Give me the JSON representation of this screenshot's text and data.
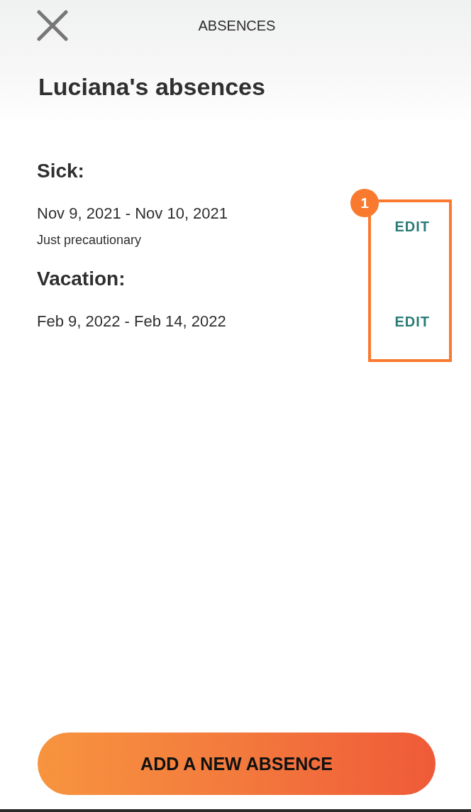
{
  "header": {
    "title": "ABSENCES"
  },
  "heading": "Luciana's absences",
  "absences": [
    {
      "category": "Sick:",
      "dates": "Nov 9, 2021 - Nov 10, 2021",
      "note": "Just precautionary",
      "action": "EDIT"
    },
    {
      "category": "Vacation:",
      "dates": "Feb 9, 2022 - Feb 14, 2022",
      "action": "EDIT"
    }
  ],
  "annotation": {
    "number": "1"
  },
  "add_button": {
    "label": "ADD A NEW ABSENCE"
  }
}
